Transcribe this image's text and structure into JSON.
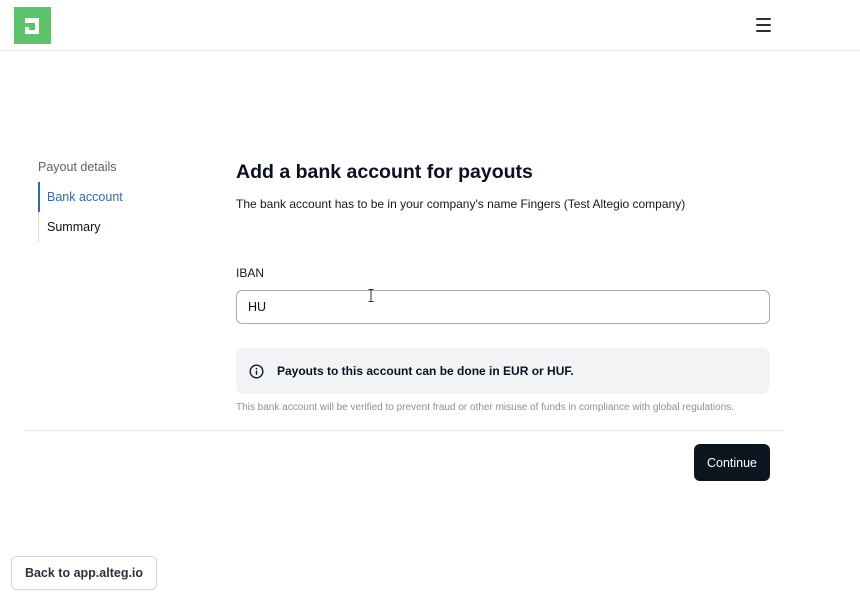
{
  "header": {
    "logo_icon": "alteg-logo-icon",
    "brand_color": "#5cc46a",
    "menu_icon": "hamburger-menu-icon"
  },
  "sidebar": {
    "title": "Payout details",
    "steps": [
      {
        "label": "Bank account",
        "active": true
      },
      {
        "label": "Summary",
        "active": false
      }
    ]
  },
  "main": {
    "title": "Add a bank account for payouts",
    "subtitle": "The bank account has to be in your company's name Fingers (Test Altegio company)",
    "iban": {
      "label": "IBAN",
      "value": "HU"
    },
    "info": {
      "icon": "info-icon",
      "text": "Payouts to this account can be done in EUR or HUF."
    },
    "fine_print": "This bank account will be verified to prevent fraud or other misuse of funds in compliance with global regulations."
  },
  "actions": {
    "continue_label": "Continue",
    "back_label": "Back to app.alteg.io"
  },
  "colors": {
    "accent": "#2f6ab8",
    "primary_button": "#0b1520"
  }
}
